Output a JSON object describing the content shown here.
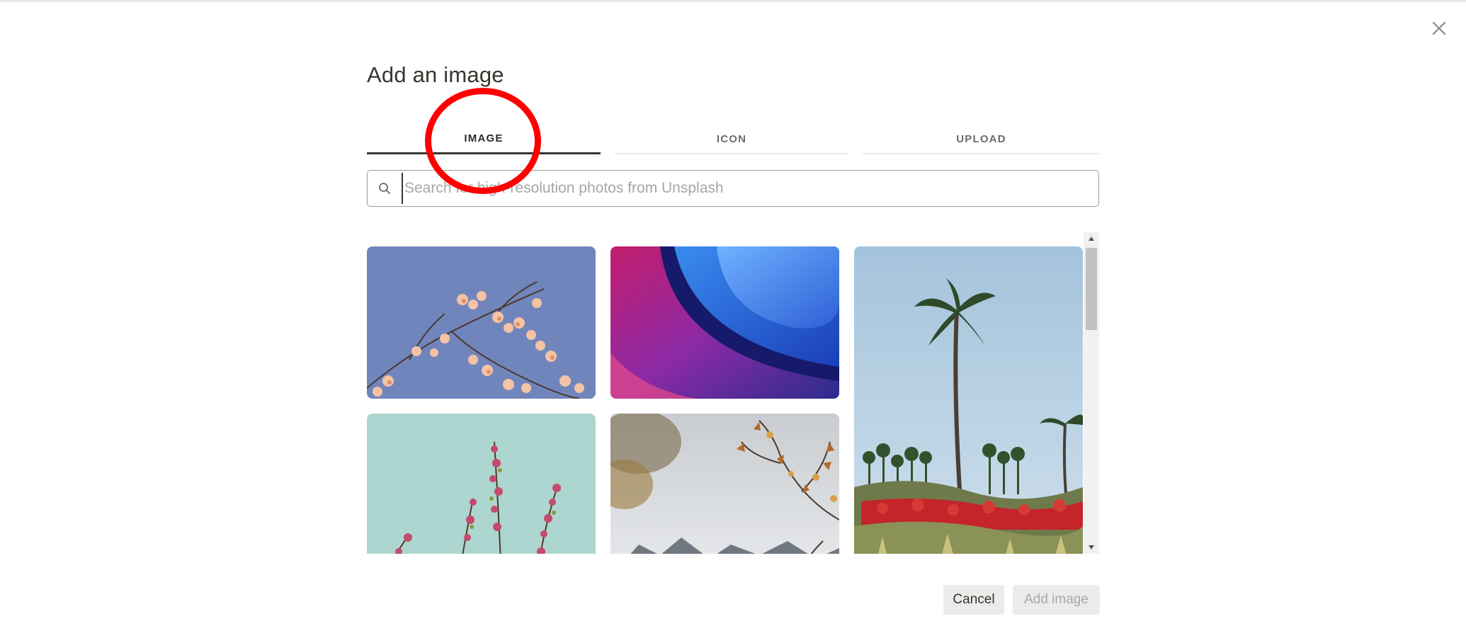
{
  "dialog": {
    "title": "Add an image",
    "close_icon": "close-icon"
  },
  "tabs": [
    {
      "label": "IMAGE",
      "active": true
    },
    {
      "label": "ICON",
      "active": false
    },
    {
      "label": "UPLOAD",
      "active": false
    }
  ],
  "search": {
    "placeholder": "Search for high-resolution photos from Unsplash",
    "value": "",
    "icon": "search-icon"
  },
  "gallery": {
    "photos": [
      {
        "subject": "blossom-branches-blue-sky"
      },
      {
        "subject": "abstract-pink-blue-curves"
      },
      {
        "subject": "palm-trees-red-flowers"
      },
      {
        "subject": "pink-blossom-teal-sky"
      },
      {
        "subject": "autumn-branch-snowy-mountains"
      }
    ]
  },
  "buttons": {
    "cancel": "Cancel",
    "add_image": "Add image"
  },
  "colors": {
    "annotation": "#ff0000",
    "text": "#37352f",
    "button_bg": "#ebebea"
  }
}
